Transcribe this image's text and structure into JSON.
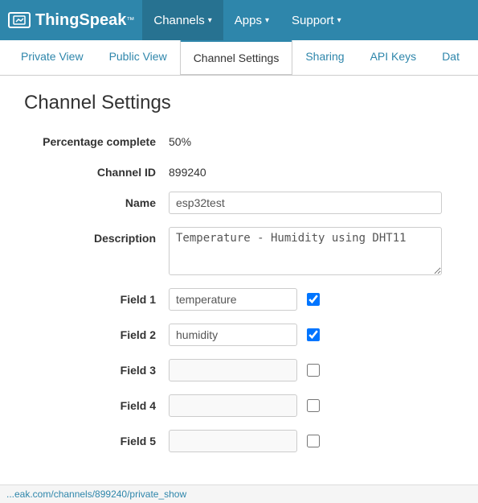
{
  "nav": {
    "logo_text": "ThingSpeak",
    "logo_tm": "™",
    "channels_label": "Channels",
    "apps_label": "Apps",
    "support_label": "Support"
  },
  "tabs": [
    {
      "label": "Private View",
      "active": false
    },
    {
      "label": "Public View",
      "active": false
    },
    {
      "label": "Channel Settings",
      "active": true
    },
    {
      "label": "Sharing",
      "active": false
    },
    {
      "label": "API Keys",
      "active": false
    },
    {
      "label": "Dat",
      "active": false
    }
  ],
  "page": {
    "title": "Channel Settings"
  },
  "form": {
    "percentage_label": "Percentage complete",
    "percentage_value": "50%",
    "channel_id_label": "Channel ID",
    "channel_id_value": "899240",
    "name_label": "Name",
    "name_value": "esp32test",
    "name_placeholder": "",
    "description_label": "Description",
    "description_value": "Temperature - Humidity using DHT11",
    "description_placeholder": ""
  },
  "fields": [
    {
      "label": "Field 1",
      "value": "temperature",
      "checked": true
    },
    {
      "label": "Field 2",
      "value": "humidity",
      "checked": true
    },
    {
      "label": "Field 3",
      "value": "",
      "checked": false
    },
    {
      "label": "Field 4",
      "value": "",
      "checked": false
    },
    {
      "label": "Field 5",
      "value": "",
      "checked": false
    }
  ],
  "status_bar": {
    "url": "...eak.com/channels/899240/private_show"
  }
}
